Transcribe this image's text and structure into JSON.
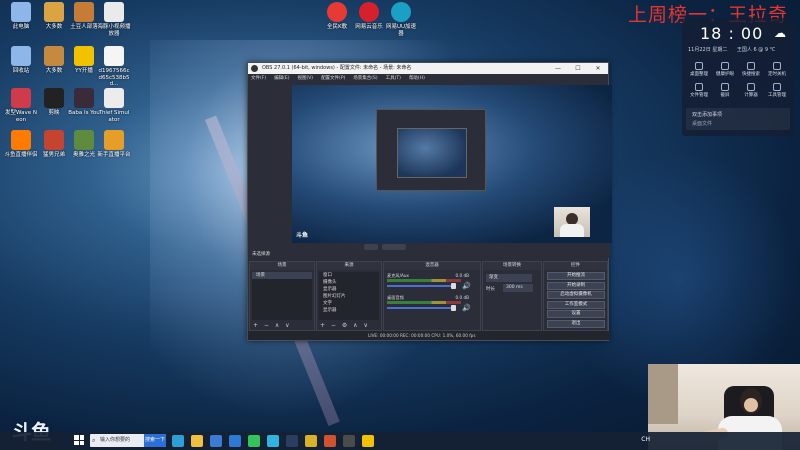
{
  "banner": {
    "text": "上周榜一：王拉奇",
    "color": "#e8342e"
  },
  "desktop_icons": [
    {
      "label": "此电脑",
      "color": "#8fb6e8",
      "icon": "computer-icon"
    },
    {
      "label": "大多数",
      "color": "#d9a441",
      "icon": "game-icon"
    },
    {
      "label": "土豆人部落",
      "color": "#c57c35",
      "icon": "game-icon"
    },
    {
      "label": "海豚小视频播放器",
      "color": "#eaeaea",
      "icon": "document-icon"
    },
    {
      "label": "回收站",
      "color": "#8fb6e8",
      "icon": "recycle-bin-icon"
    },
    {
      "label": "大多数",
      "color": "#c58a40",
      "icon": "game-icon"
    },
    {
      "label": "YY开播",
      "color": "#f2c200",
      "icon": "yy-icon"
    },
    {
      "label": "d1967566cd65c538b5d...",
      "color": "#f5f5f5",
      "icon": "file-icon"
    },
    {
      "label": "发型Wave Neon",
      "color": "#cf3b4a",
      "icon": "game-icon"
    },
    {
      "label": "剪映",
      "color": "#222222",
      "icon": "capcut-icon"
    },
    {
      "label": "Baba Is You",
      "color": "#3a2b3a",
      "icon": "game-icon"
    },
    {
      "label": "Thief Simulator",
      "color": "#ececec",
      "icon": "game-icon"
    },
    {
      "label": "斗鱼直播伴侣",
      "color": "#ff7a00",
      "icon": "game-icon"
    },
    {
      "label": "猛男兄弟",
      "color": "#c4442f",
      "icon": "game-icon"
    },
    {
      "label": "奥雅之光",
      "color": "#5e8b3d",
      "icon": "game-icon"
    },
    {
      "label": "新手直播平台",
      "color": "#e59f28",
      "icon": "game-icon"
    }
  ],
  "top_icons": [
    {
      "label": "全民K歌",
      "color": "#e83a35",
      "icon": "karaoke-icon"
    },
    {
      "label": "网易云音乐",
      "color": "#d6202c",
      "icon": "netease-music-icon"
    },
    {
      "label": "网易UU加速器",
      "color": "#1aa0c4",
      "icon": "uu-accelerator-icon"
    }
  ],
  "widget": {
    "time": "18 : 00",
    "date": "11月22日   星期二",
    "weather": "王国人 6 @ 9 ℃",
    "tools": [
      {
        "label": "桌面整理"
      },
      {
        "label": "健康护眼"
      },
      {
        "label": "快捷搜索"
      },
      {
        "label": "定时关机"
      },
      {
        "label": "文件管理"
      },
      {
        "label": "截屏"
      },
      {
        "label": "计算器"
      },
      {
        "label": "工具管理"
      }
    ],
    "search_hint": "双击添加事项",
    "search_sub": "桌面文件"
  },
  "obs": {
    "title": "OBS 27.0.1 (64-bit, windows) - 配置文件: 未命名 - 场景: 未命名",
    "menu": [
      "文件(F)",
      "编辑(E)",
      "视图(V)",
      "配置文件(P)",
      "场景集合(S)",
      "工具(T)",
      "帮助(H)"
    ],
    "scene_strip": "未选择源",
    "docks": {
      "scenes": {
        "title": "场景",
        "items": [
          "场景"
        ],
        "foot": "+ − ∧ ∨"
      },
      "sources": {
        "title": "来源",
        "items": [
          "窗口",
          "摄像头",
          "显示器",
          "图片幻灯片",
          "文字",
          "显示器"
        ],
        "foot": "+ − ⚙ ∧ ∨"
      },
      "mixer": {
        "title": "混音器",
        "channels": [
          {
            "name": "麦克风/Aux",
            "level": "0.0 dB"
          },
          {
            "name": "桌面音频",
            "level": "0.0 dB"
          }
        ]
      },
      "transitions": {
        "title": "场景转换",
        "type": "渐变",
        "duration_label": "时长",
        "duration": "300 ms"
      },
      "controls": {
        "title": "控件",
        "buttons": [
          "开始推流",
          "开始录制",
          "启动虚拟摄像机",
          "工作室模式",
          "设置",
          "退出"
        ]
      }
    },
    "status": "LIVE: 00:00:00   REC: 00:00:00   CPU: 1.0%, 60.00 fps"
  },
  "watermark": "斗鱼",
  "taskbar": {
    "search_placeholder": "输入你想要的",
    "search_button": "搜索一下",
    "apps": [
      {
        "icon": "edge-icon",
        "color": "#2d9fd8"
      },
      {
        "icon": "files-icon",
        "color": "#f0c040"
      },
      {
        "icon": "mail-icon",
        "color": "#3b7bd6"
      },
      {
        "icon": "store-icon",
        "color": "#2c7ad6"
      },
      {
        "icon": "wechat-icon",
        "color": "#35c35b"
      },
      {
        "icon": "chat-icon",
        "color": "#2fb3e0"
      },
      {
        "icon": "steam-icon",
        "color": "#2a3f5f"
      },
      {
        "icon": "g-icon",
        "color": "#d8b12a"
      },
      {
        "icon": "app-icon",
        "color": "#d0522f"
      },
      {
        "icon": "obs-icon",
        "color": "#4b4b4b"
      },
      {
        "icon": "yy-icon",
        "color": "#f2c200"
      }
    ],
    "tray_text": "CH"
  }
}
